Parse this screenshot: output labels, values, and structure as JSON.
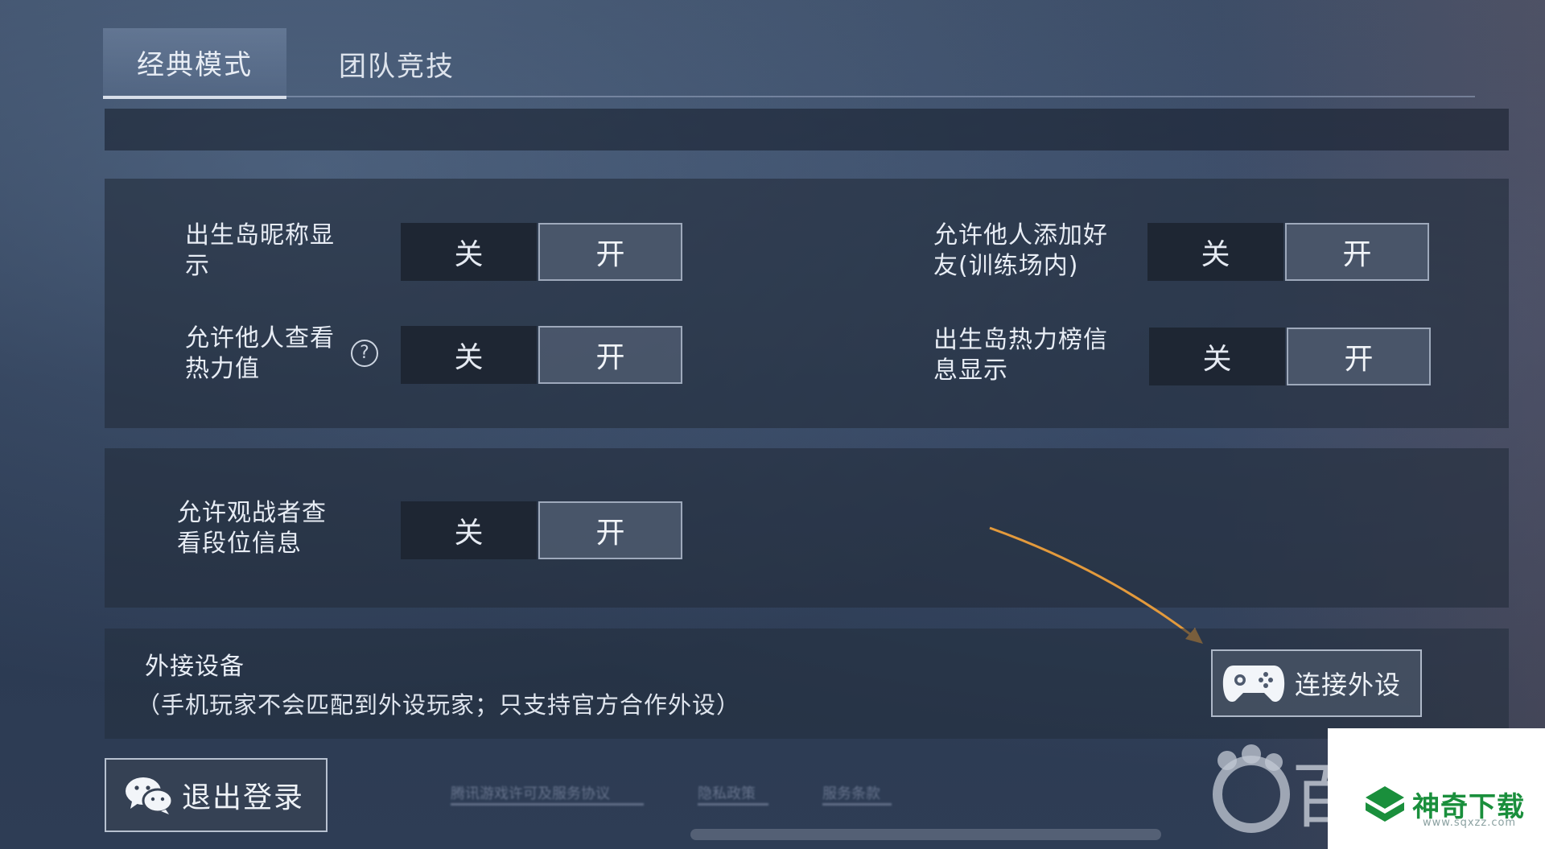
{
  "tabs": [
    {
      "label": "经典模式",
      "active": true
    },
    {
      "label": "团队竞技",
      "active": false
    }
  ],
  "settings": {
    "birth_nickname": {
      "label": "出生岛昵称显\n示",
      "off": "关",
      "on": "开"
    },
    "allow_add_friend": {
      "label": "允许他人添加好\n友(训练场内)",
      "off": "关",
      "on": "开"
    },
    "allow_view_heat": {
      "label": "允许他人查看\n热力值",
      "off": "关",
      "on": "开",
      "help": "?"
    },
    "birth_heat_board": {
      "label": "出生岛热力榜信\n息显示",
      "off": "关",
      "on": "开"
    },
    "spectator_rank": {
      "label": "允许观战者查\n看段位信息",
      "off": "关",
      "on": "开"
    }
  },
  "device": {
    "title": "外接设备",
    "desc": "（手机玩家不会匹配到外设玩家；只支持官方合作外设）",
    "connect_label": "连接外设"
  },
  "logout_label": "退出登录",
  "footer_links": [
    "腾讯游戏许可及服务协议",
    "隐私政策",
    "服务条款"
  ],
  "watermark": {
    "left_text": "百",
    "brand": "神奇下载",
    "site": "www.sqxzz.com"
  },
  "colors": {
    "arrow": "#e39a3c",
    "brand_green": "#1a8f3c"
  }
}
